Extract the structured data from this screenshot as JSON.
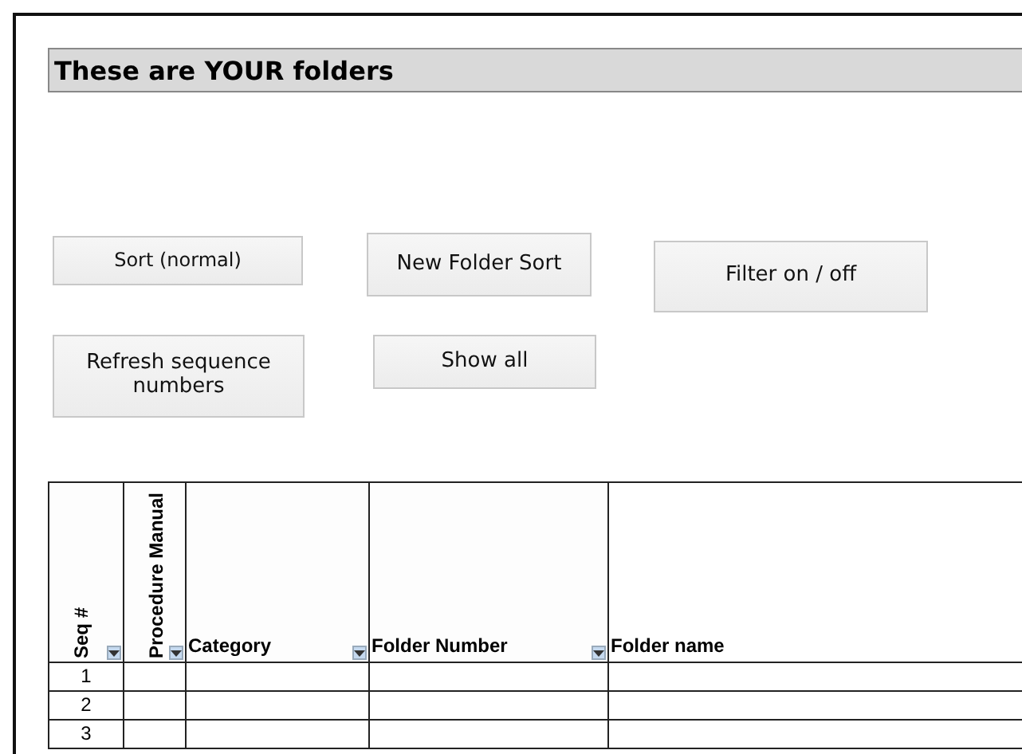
{
  "title": "These are YOUR folders",
  "buttons": [
    [
      "Sort (normal)",
      "New Folder Sort",
      "Filter on / off"
    ],
    [
      "Refresh sequence numbers",
      "Show all"
    ]
  ],
  "table": {
    "columns": [
      {
        "label": "Seq #",
        "kind": "vertical",
        "filter": true
      },
      {
        "label": "Procedure Manual",
        "kind": "vertical",
        "filter": true
      },
      {
        "label": "Category",
        "kind": "horizontal",
        "filter": true
      },
      {
        "label": "Folder Number",
        "kind": "horizontal",
        "filter": true
      },
      {
        "label": "Folder name",
        "kind": "horizontal"
      }
    ],
    "rows": [
      [
        "1",
        "",
        "",
        "",
        ""
      ],
      [
        "2",
        "",
        "",
        "",
        ""
      ],
      [
        "3",
        "",
        "",
        "",
        ""
      ]
    ]
  }
}
